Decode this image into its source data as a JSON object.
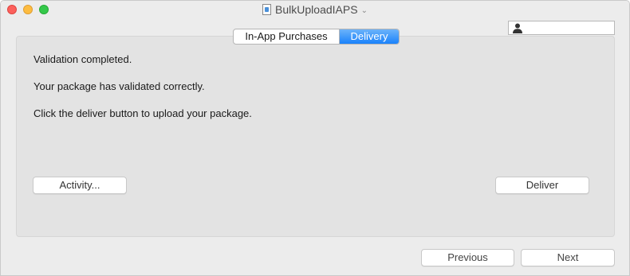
{
  "window": {
    "title": "BulkUploadIAPS",
    "title_chevron": "⌄",
    "traffic_colors": {
      "close": "#fc605c",
      "minimize": "#fdbc40",
      "maximize": "#34c84a"
    }
  },
  "account": {
    "value": ""
  },
  "tabs": [
    {
      "label": "In-App Purchases",
      "active": false
    },
    {
      "label": "Delivery",
      "active": true
    }
  ],
  "accent_color": "#1a82fb",
  "messages": {
    "line1": "Validation completed.",
    "line2": "Your package has validated correctly.",
    "line3": "Click the deliver button to upload your package."
  },
  "buttons": {
    "activity": "Activity...",
    "deliver": "Deliver",
    "previous": "Previous",
    "next": "Next"
  },
  "icons": {
    "document": "document-icon",
    "account": "person-icon",
    "chevron": "chevron-down-icon"
  }
}
